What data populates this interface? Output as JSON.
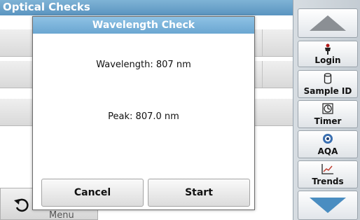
{
  "background": {
    "title": "Optical Checks",
    "menu_label": "Menu"
  },
  "dialog": {
    "title": "Wavelength Check",
    "wavelength_line": "Wavelength: 807 nm",
    "peak_line": "Peak:  807.0 nm",
    "cancel_label": "Cancel",
    "start_label": "Start"
  },
  "sidebar": {
    "login_label": "Login",
    "sample_id_label": "Sample ID",
    "timer_label": "Timer",
    "aqa_label": "AQA",
    "trends_label": "Trends"
  },
  "icons": {
    "scroll_up": "triangle-up-icon",
    "scroll_down": "triangle-down-icon",
    "login": "person-icon",
    "sample_id": "cylinder-icon",
    "timer": "timer-icon",
    "aqa": "aqa-icon",
    "trends": "trend-chart-icon",
    "back": "back-arrow-icon"
  },
  "colors": {
    "title_bar": "#6aa6d1",
    "accent_arrow": "#3f7fb0"
  }
}
